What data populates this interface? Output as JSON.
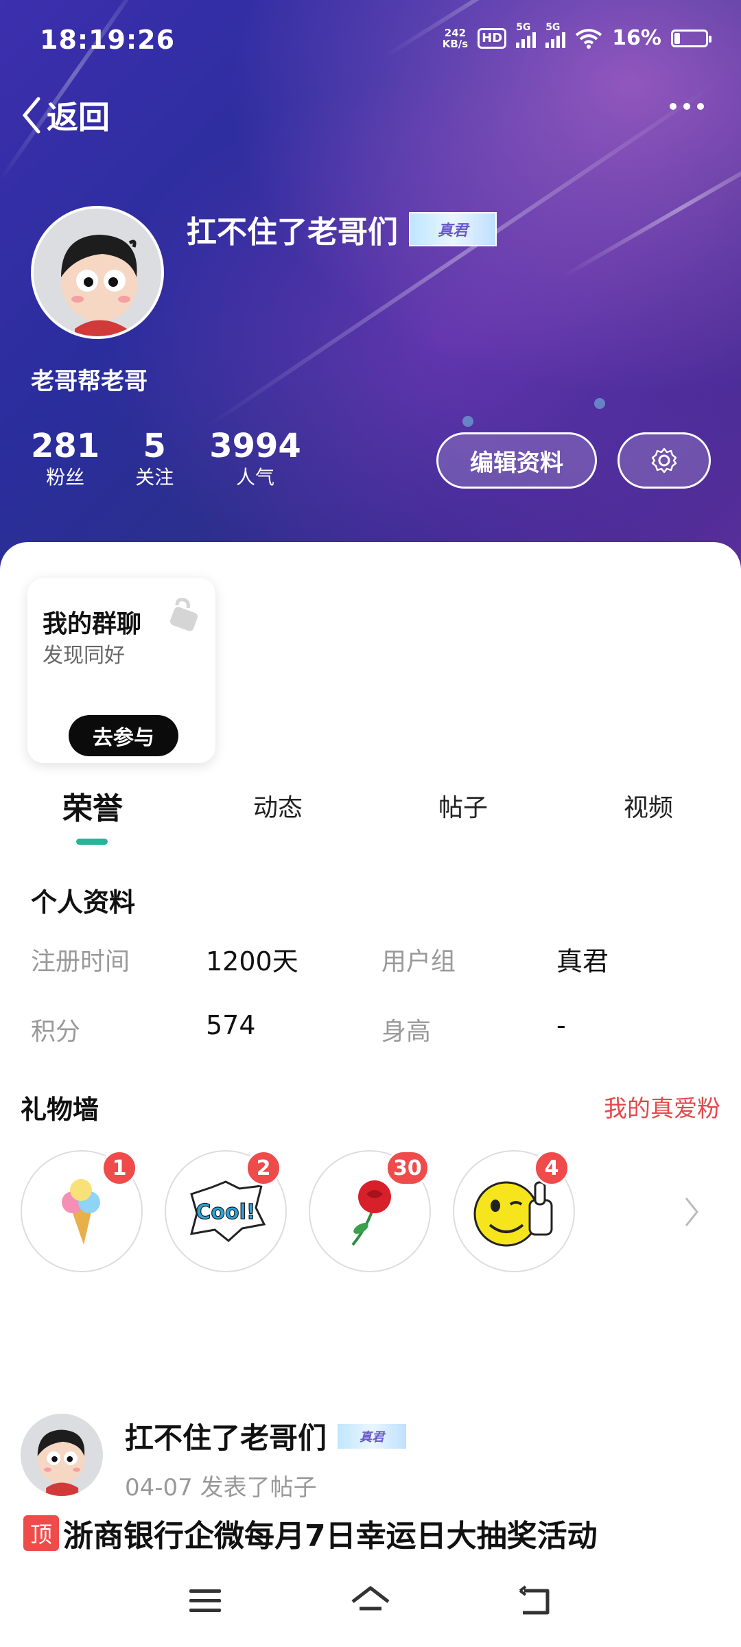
{
  "status_bar": {
    "time": "18:19:26",
    "net_speed_value": "242",
    "net_speed_unit": "KB/s",
    "hd_label": "HD",
    "sim1_label": "5G",
    "sim2_label": "5G",
    "battery": "16%"
  },
  "header": {
    "back_label": "返回",
    "more_icon": "more-dots-icon"
  },
  "profile": {
    "username": "扛不住了老哥们",
    "title_badge": "真君",
    "subtitle": "老哥帮老哥",
    "stats": [
      {
        "value": "281",
        "label": "粉丝"
      },
      {
        "value": "5",
        "label": "关注"
      },
      {
        "value": "3994",
        "label": "人气"
      }
    ],
    "edit_button": "编辑资料"
  },
  "group_card": {
    "title": "我的群聊",
    "subtitle": "发现同好",
    "button": "去参与"
  },
  "tabs": [
    "荣誉",
    "动态",
    "帖子",
    "视频"
  ],
  "personal_info": {
    "title": "个人资料",
    "rows": [
      {
        "label": "注册时间",
        "value": "1200天",
        "label2": "用户组",
        "value2": "真君"
      },
      {
        "label": "积分",
        "value": "574",
        "label2": "身高",
        "value2": "-"
      }
    ]
  },
  "gifts": {
    "title": "礼物墙",
    "link": "我的真爱粉",
    "items": [
      {
        "name": "ice-cream",
        "count": "1"
      },
      {
        "name": "cool",
        "count": "2"
      },
      {
        "name": "rose",
        "count": "30"
      },
      {
        "name": "thumbs-up",
        "count": "4"
      }
    ],
    "cool_text": "Cool!"
  },
  "post": {
    "author": "扛不住了老哥们",
    "meta": "04-07 发表了帖子",
    "pin_label": "顶",
    "title": "浙商银行企微每月7日幸运日大抽奖活动"
  },
  "colors": {
    "accent_tab": "#2bb39a",
    "link_red": "#e5484d",
    "count_red": "#ef4b4b"
  }
}
